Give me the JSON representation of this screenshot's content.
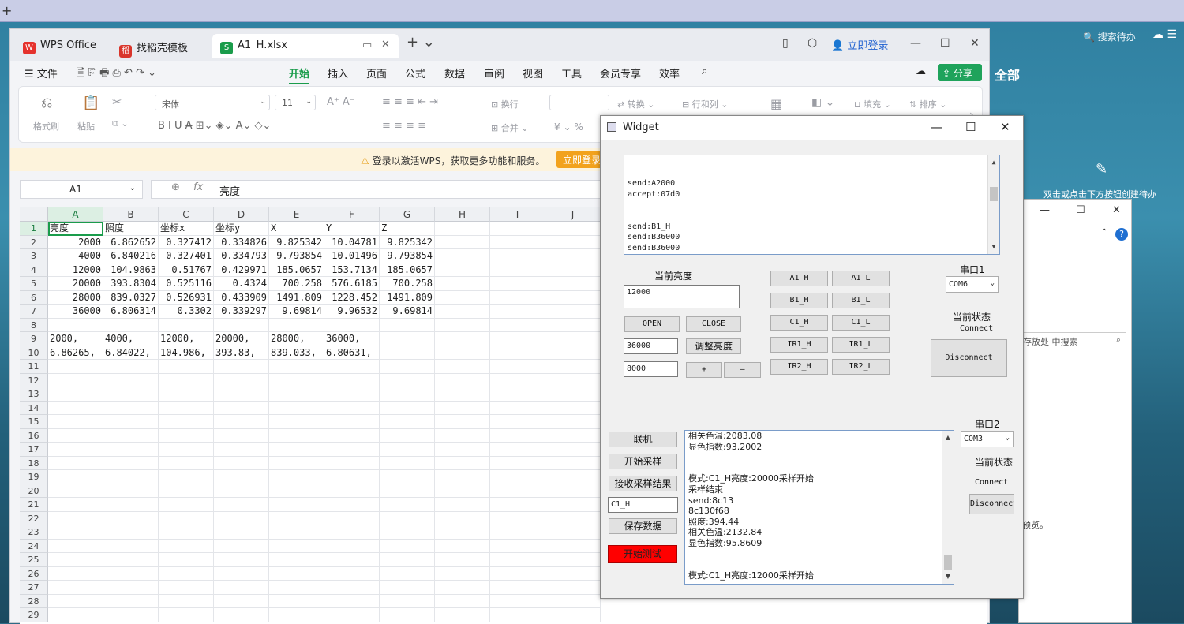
{
  "desktop": {
    "search_label": "搜索待办",
    "all_label": "全部",
    "hint": "双击或点击下方按钮创建待办"
  },
  "win2": {
    "search_placeholder": "存放处 中搜索",
    "preview_text": "预览。"
  },
  "wps": {
    "tabs": [
      "WPS Office",
      "找稻壳模板",
      "A1_H.xlsx"
    ],
    "login": "立即登录",
    "file_menu": "文件",
    "menus": [
      "开始",
      "插入",
      "页面",
      "公式",
      "数据",
      "审阅",
      "视图",
      "工具",
      "会员专享",
      "效率"
    ],
    "share": "分享",
    "ribbon": {
      "format_painter": "格式刷",
      "paste": "粘贴",
      "font": "宋体",
      "size": "11",
      "wrap": "换行",
      "merge": "合并",
      "convert": "转换",
      "rowcol": "行和列",
      "fill": "填充",
      "sort": "排序"
    },
    "banner_msg": "登录以激活WPS，获取更多功能和服务。",
    "banner_btn": "立即登录",
    "namebox": "A1",
    "formula": "亮度",
    "columns": [
      "A",
      "B",
      "C",
      "D",
      "E",
      "F",
      "G",
      "H",
      "I",
      "J"
    ],
    "rows": [
      [
        "亮度",
        "照度",
        "坐标x",
        "坐标y",
        "X",
        "Y",
        "Z"
      ],
      [
        "2000",
        "6.862652",
        "0.327412",
        "0.334826",
        "9.825342",
        "10.04781",
        "9.825342"
      ],
      [
        "4000",
        "6.840216",
        "0.327401",
        "0.334793",
        "9.793854",
        "10.01496",
        "9.793854"
      ],
      [
        "12000",
        "104.9863",
        "0.51767",
        "0.429971",
        "185.0657",
        "153.7134",
        "185.0657"
      ],
      [
        "20000",
        "393.8304",
        "0.525116",
        "0.4324",
        "700.258",
        "576.6185",
        "700.258"
      ],
      [
        "28000",
        "839.0327",
        "0.526931",
        "0.433909",
        "1491.809",
        "1228.452",
        "1491.809"
      ],
      [
        "36000",
        "6.806314",
        "0.3302",
        "0.339297",
        "9.69814",
        "9.96532",
        "9.69814"
      ],
      [
        "",
        "",
        "",
        "",
        "",
        "",
        ""
      ],
      [
        "2000,",
        "4000,",
        "12000,",
        "20000,",
        "28000,",
        "36000,",
        ""
      ],
      [
        "6.86265,",
        "6.84022,",
        "104.986,",
        "393.83,",
        "839.033,",
        "6.80631,",
        ""
      ]
    ]
  },
  "widget": {
    "title": "Widget",
    "log1": [
      "",
      "",
      "send:A2000",
      "accept:07d0",
      "",
      "",
      "send:B1_H",
      "send:B36000",
      "send:B36000"
    ],
    "current_brightness_label": "当前亮度",
    "current_brightness": "12000",
    "open": "OPEN",
    "close": "CLOSE",
    "value1": "36000",
    "adjust": "调整亮度",
    "value2": "8000",
    "plus": "+",
    "minus": "—",
    "mode_buttons": [
      [
        "A1_H",
        "A1_L"
      ],
      [
        "B1_H",
        "B1_L"
      ],
      [
        "C1_H",
        "C1_L"
      ],
      [
        "IR1_H",
        "IR1_L"
      ],
      [
        "IR2_H",
        "IR2_L"
      ]
    ],
    "port1_label": "串口1",
    "port1": "COM6",
    "status_label": "当前状态",
    "status1": "Connect",
    "disconnect": "Disconnect",
    "port2_label": "串口2",
    "port2": "COM3",
    "status2": "Connect",
    "disconnect2": "Disconnect",
    "connect_btn": "联机",
    "start_sample": "开始采样",
    "receive_result": "接收采样结果",
    "mode_value": "C1_H",
    "save_data": "保存数据",
    "start_test": "开始测试",
    "log2": [
      "相关色温:2083.08",
      "显色指数:93.2002",
      "",
      "",
      "模式:C1_H亮度:20000采样开始",
      "采样结束",
      "send:8c13",
      "8c130f68",
      "照度:394.44",
      "相关色温:2132.84",
      "显色指数:95.8609",
      "",
      "",
      "模式:C1_H亮度:12000采样开始"
    ]
  }
}
